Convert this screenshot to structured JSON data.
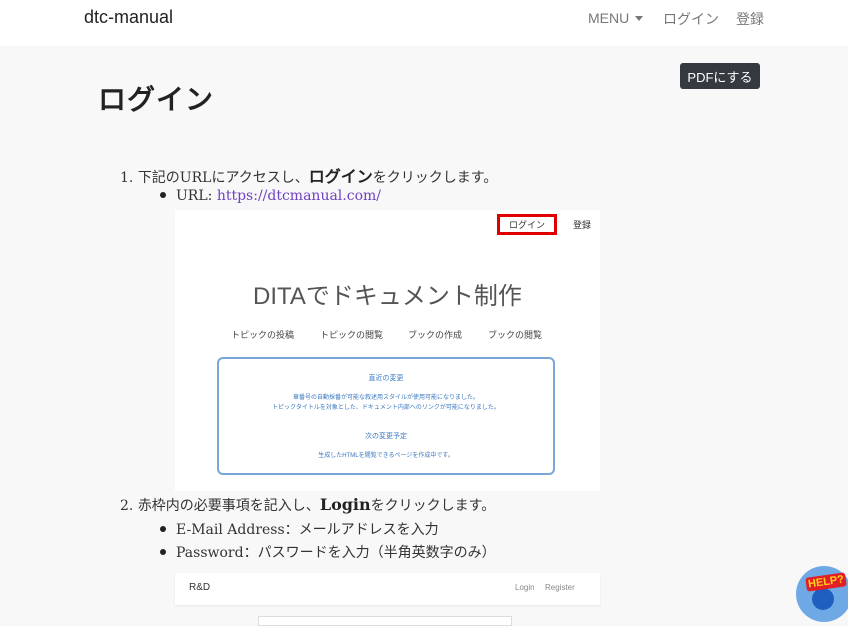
{
  "navbar": {
    "brand": "dtc-manual",
    "menu_label": "MENU",
    "login_label": "ログイン",
    "register_label": "登録"
  },
  "pdf_button": "PDFにする",
  "page_title": "ログイン",
  "steps": [
    {
      "number": "1.",
      "text_before": "下記のURLにアクセスし、",
      "emphasis": "ログイン",
      "text_after": "をクリックします。",
      "bullets": [
        {
          "label": "URL: ",
          "link": "https://dtcmanual.com/"
        }
      ]
    },
    {
      "number": "2.",
      "text_before": "赤枠内の必要事項を記入し、",
      "emphasis": "Login",
      "text_after": "をクリックします。",
      "bullets": [
        {
          "label": "E-Mail Address：メールアドレスを入力"
        },
        {
          "label": "Password：パスワードを入力（半角英数字のみ）"
        }
      ]
    }
  ],
  "screenshot1": {
    "login": "ログイン",
    "register": "登録",
    "headline": "DITAでドキュメント制作",
    "menu": [
      "トピックの投稿",
      "トピックの閲覧",
      "ブックの作成",
      "ブックの閲覧"
    ],
    "recent_title": "直近の変更",
    "recent_lines": [
      "章番号の自動採番が可能な叙述用スタイルが使用可能になりました。",
      "トピックタイトルを対象とした、ドキュメント内部へのリンクが可能になりました。"
    ],
    "next_title": "次の変更予定",
    "next_lines": [
      "生成したHTMLを閲覧できるページを作成中です。"
    ]
  },
  "screenshot2": {
    "brand": "R&D",
    "login": "Login",
    "register": "Register"
  },
  "help_badge": "HELP?",
  "colors": {
    "accent_link": "#6f42c1",
    "highlight_box": "#e00000",
    "panel_border": "#7aa6d6"
  }
}
